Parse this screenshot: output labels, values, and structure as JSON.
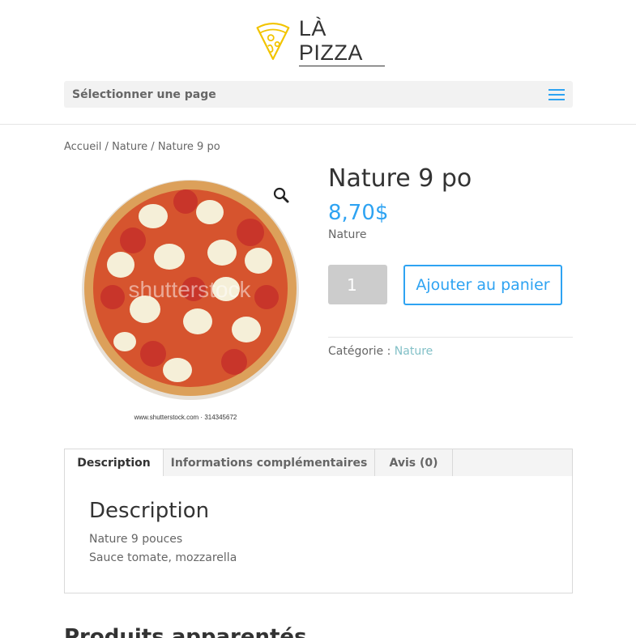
{
  "brand": {
    "name": "LÀ PIZZA",
    "accent": "#f2c400"
  },
  "nav": {
    "select_label": "Sélectionner une page",
    "menu_icon": "hamburger-menu-icon",
    "accent": "#2ea3f2"
  },
  "breadcrumb": {
    "home": "Accueil",
    "sep1": " / ",
    "category": "Nature",
    "sep2": " / ",
    "current": "Nature 9 po"
  },
  "product": {
    "title": "Nature 9 po",
    "price": "8,70$",
    "short_description": "Nature",
    "quantity": "1",
    "add_to_cart_label": "Ajouter au panier",
    "category_label": "Catégorie : ",
    "category_link": "Nature",
    "zoom_icon": "magnifier-icon",
    "image": {
      "watermark": "shutterstock",
      "caption": "www.shutterstock.com · 314345672"
    }
  },
  "tabs": [
    {
      "label": "Description",
      "active": true
    },
    {
      "label": "Informations complémentaires",
      "active": false
    },
    {
      "label": "Avis (0)",
      "active": false
    }
  ],
  "description": {
    "heading": "Description",
    "line1": "Nature 9 pouces",
    "line2": "Sauce tomate, mozzarella"
  },
  "related": {
    "heading": "Produits apparentés"
  }
}
